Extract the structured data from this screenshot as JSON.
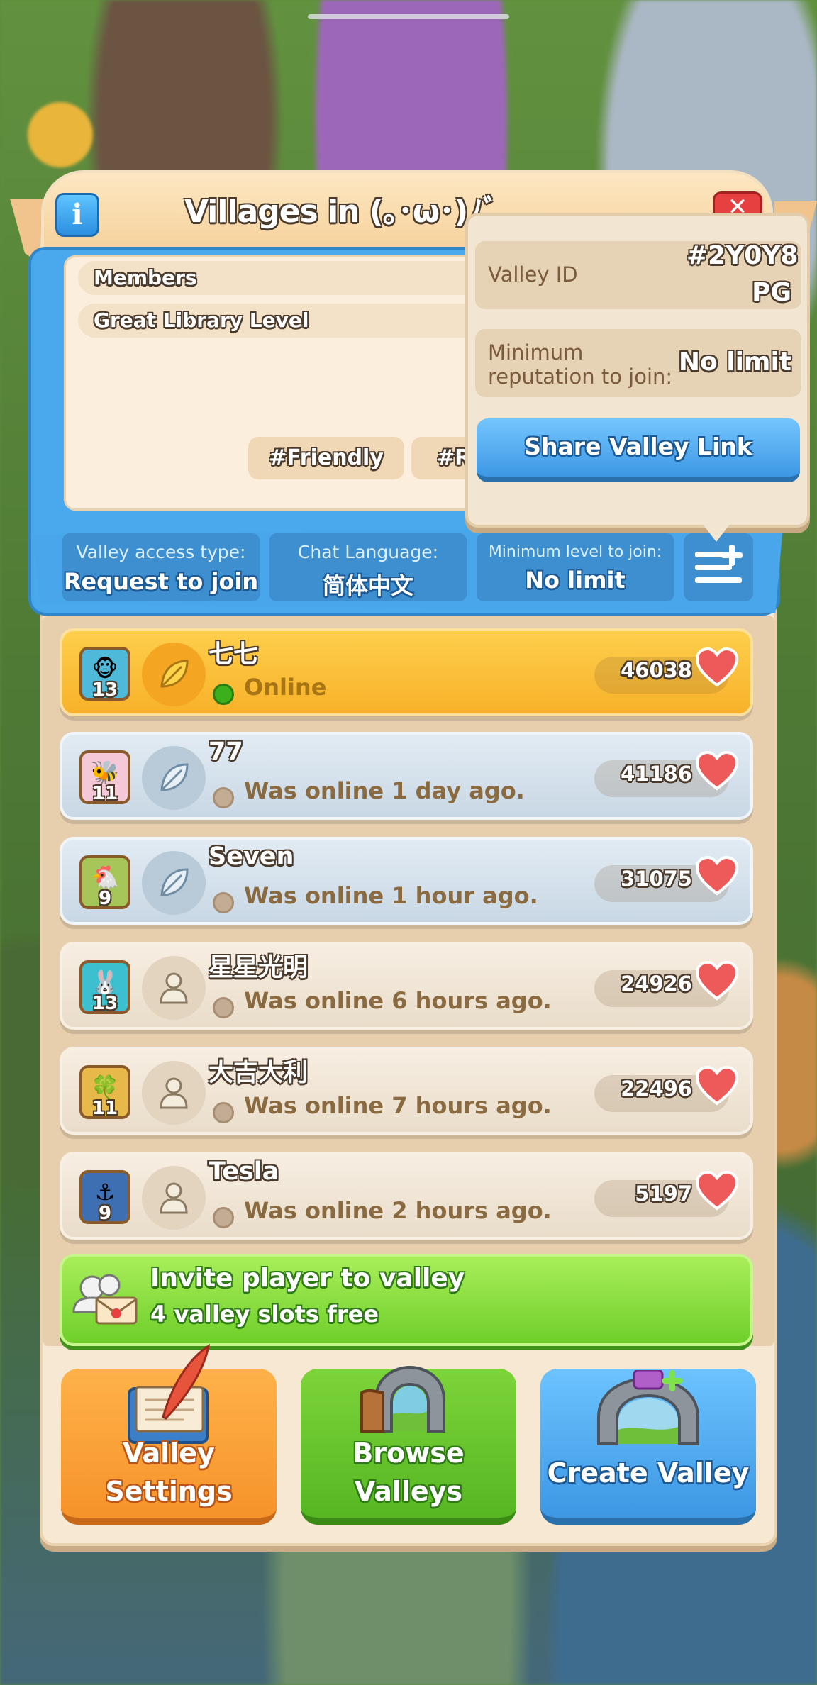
{
  "header": {
    "title": "Villages in (｡･ω･)ﾉﾞ",
    "info_label": "i",
    "close_label": "✕"
  },
  "info": {
    "members_label": "Members",
    "library_label": "Great Library Level",
    "tags": [
      "#Friendly",
      "#R"
    ]
  },
  "access": {
    "type_label": "Valley access type:",
    "type_value": "Request to join",
    "chat_label": "Chat Language:",
    "chat_value": "简体中文",
    "minlevel_label": "Minimum level to join:",
    "minlevel_value": "No limit"
  },
  "popup": {
    "valley_id_label": "Valley ID",
    "valley_id_line1": "#2Y0Y8",
    "valley_id_line2": "PG",
    "min_rep_label_1": "Minimum",
    "min_rep_label_2": "reputation to join:",
    "min_rep_value": "No limit",
    "share_label": "Share Valley Link"
  },
  "members": [
    {
      "name": "七七",
      "level": "13",
      "status": "Online",
      "score": "46038",
      "online": true,
      "tier": "gold",
      "avatar_icon": "monkey-icon"
    },
    {
      "name": "77",
      "level": "11",
      "status": "Was online 1 day ago.",
      "score": "41186",
      "online": false,
      "tier": "silver",
      "avatar_icon": "bee-icon"
    },
    {
      "name": "Seven",
      "level": "9",
      "status": "Was online 1 hour ago.",
      "score": "31075",
      "online": false,
      "tier": "silver",
      "avatar_icon": "chicken-icon"
    },
    {
      "name": "星星光明",
      "level": "13",
      "status": "Was online 6 hours ago.",
      "score": "24926",
      "online": false,
      "tier": "plain",
      "avatar_icon": "rabbit-icon"
    },
    {
      "name": "大吉大利",
      "level": "11",
      "status": "Was online 7 hours ago.",
      "score": "22496",
      "online": false,
      "tier": "plain",
      "avatar_icon": "clover-icon"
    },
    {
      "name": "Tesla",
      "level": "9",
      "status": "Was online 2 hours ago.",
      "score": "5197",
      "online": false,
      "tier": "plain",
      "avatar_icon": "anchor-icon"
    }
  ],
  "invite": {
    "line1": "Invite player to valley",
    "line2": "4 valley slots free"
  },
  "bottom": {
    "settings_1": "Valley",
    "settings_2": "Settings",
    "browse_1": "Browse",
    "browse_2": "Valleys",
    "create": "Create Valley"
  },
  "colors": {
    "panel": "#f6e8d2",
    "blue": "#4aa8ec",
    "gold_row": "#f8b12a",
    "green": "#6fcf2a",
    "orange": "#f6932a",
    "heart": "#ee5a5a"
  }
}
